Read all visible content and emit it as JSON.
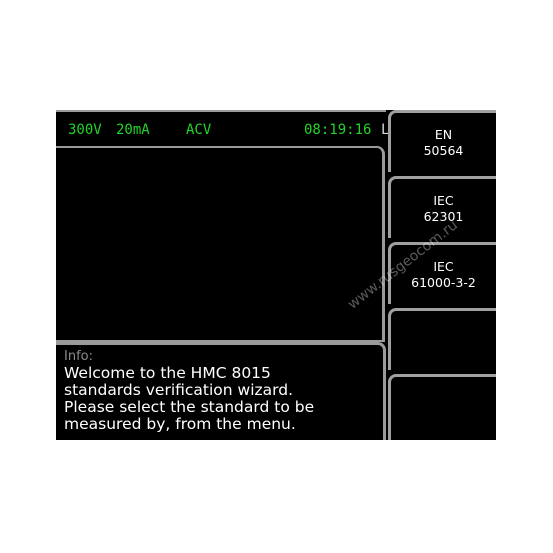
{
  "status_bar": {
    "voltage_range": "300V",
    "current_range": "20mA",
    "mode": "ACV",
    "time": "08:19:16",
    "unit_cut": "L"
  },
  "info": {
    "heading": "Info:",
    "lines": [
      "Welcome to the HMC 8015",
      "standards verification wizard.",
      "Please select the standard to be",
      "measured by, from the menu."
    ]
  },
  "softkeys": [
    {
      "line1": "EN",
      "line2": "50564"
    },
    {
      "line1": "IEC",
      "line2": "62301"
    },
    {
      "line1": "IEC",
      "line2": "61000-3-2"
    },
    {
      "line1": "",
      "line2": ""
    },
    {
      "line1": "",
      "line2": ""
    }
  ],
  "watermark": "www.rusgeocom.ru",
  "colors": {
    "status_text": "#22d329",
    "background": "#000000",
    "frame": "#9a9a9a"
  }
}
